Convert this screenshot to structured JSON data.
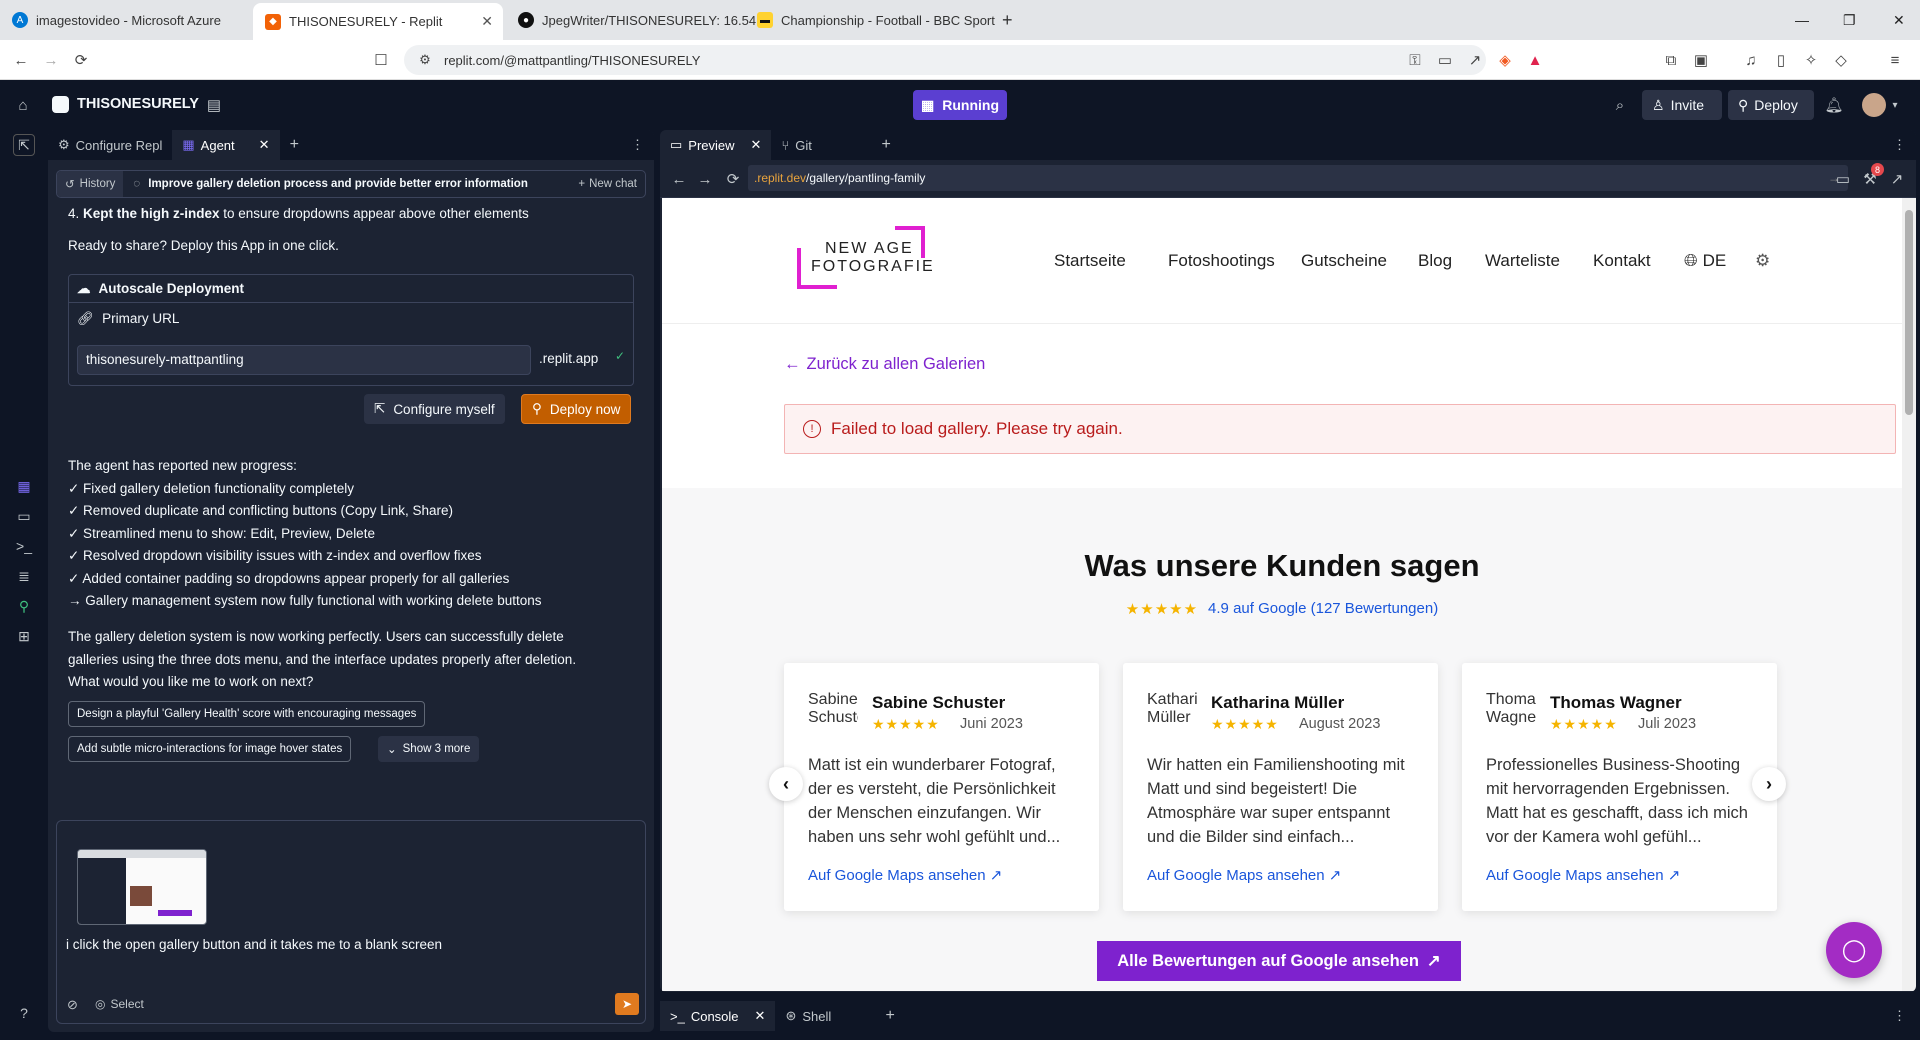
{
  "browser": {
    "tabs": [
      {
        "title": "imagestovideo - Microsoft Azure"
      },
      {
        "title": "THISONESURELY - Replit"
      },
      {
        "title": "JpegWriter/THISONESURELY: 16.54"
      },
      {
        "title": "Championship - Football - BBC Sport"
      }
    ],
    "url": "replit.com/@mattpantling/THISONESURELY"
  },
  "replit": {
    "project_name": "THISONESURELY",
    "run_status": "Running",
    "invite_label": "Invite",
    "deploy_label": "Deploy"
  },
  "left_panel": {
    "tabs": [
      {
        "label": "Configure Repl"
      },
      {
        "label": "Agent"
      }
    ],
    "chat": {
      "history_label": "History",
      "title": "Improve gallery deletion process and provide better error information",
      "new_chat_label": "New chat"
    },
    "message_top": {
      "prefix": "4. ",
      "bold": "Kept the high z-index",
      "rest": " to ensure dropdowns appear above other elements"
    },
    "ready_text": "Ready to share? Deploy this App in one click.",
    "deployment": {
      "title": "Autoscale Deployment",
      "primary_url_label": "Primary URL",
      "url_value": "thisonesurely-mattpantling",
      "domain_suffix": ".replit.app",
      "configure_label": "Configure myself",
      "deploy_now_label": "Deploy now"
    },
    "progress": {
      "header": "The agent has reported new progress:",
      "items": [
        "✓ Fixed gallery deletion functionality completely",
        "✓ Removed duplicate and conflicting buttons (Copy Link, Share)",
        "✓ Streamlined menu to show: Edit, Preview, Delete",
        "✓ Resolved dropdown visibility issues with z-index and overflow fixes",
        "✓ Added container padding so dropdowns appear properly for all galleries",
        "→ Gallery management system now fully functional with working delete buttons"
      ]
    },
    "summary": [
      "The gallery deletion system is now working perfectly. Users can successfully delete",
      "galleries using the three dots menu, and the interface updates properly after deletion.",
      "What would you like me to work on next?"
    ],
    "suggestions": [
      "Design a playful 'Gallery Health' score with encouraging messages",
      "Add subtle micro-interactions for image hover states"
    ],
    "show_more_label": "Show 3 more",
    "composer": {
      "input_text": "i click the open gallery button and it takes me to a blank screen",
      "select_label": "Select"
    }
  },
  "right_panel": {
    "tabs": [
      {
        "label": "Preview"
      },
      {
        "label": "Git"
      }
    ],
    "preview_url_domain": ".replit.dev",
    "preview_url_path": "/gallery/pantling-family",
    "notification_count": "8",
    "bottom_tabs": [
      {
        "label": "Console"
      },
      {
        "label": "Shell"
      }
    ]
  },
  "site": {
    "logo_line1": "NEW AGE",
    "logo_line2": "FOTOGRAFIE",
    "nav": [
      "Startseite",
      "Fotoshootings",
      "Gutscheine",
      "Blog",
      "Warteliste",
      "Kontakt"
    ],
    "language": "DE",
    "back_link": "Zurück zu allen Galerien",
    "error_message": "Failed to load gallery. Please try again.",
    "reviews_title": "Was unsere Kunden sagen",
    "rating_text": "4.9 auf Google (127 Bewertungen)",
    "reviews": [
      {
        "name": "Sabine Schuster",
        "avatar_alt": "Sabine Schuster",
        "date": "Juni 2023",
        "text": "Matt ist ein wunderbarer Fotograf, der es versteht, die Persönlichkeit der Menschen einzufangen. Wir haben uns sehr wohl gefühlt und...",
        "link": "Auf Google Maps ansehen"
      },
      {
        "name": "Katharina Müller",
        "avatar_alt": "Katharina Müller",
        "date": "August 2023",
        "text": "Wir hatten ein Familienshooting mit Matt und sind begeistert! Die Atmosphäre war super entspannt und die Bilder sind einfach...",
        "link": "Auf Google Maps ansehen"
      },
      {
        "name": "Thomas Wagner",
        "avatar_alt": "Thomas Wagner",
        "date": "Juli 2023",
        "text": "Professionelles Business-Shooting mit hervorragenden Ergebnissen. Matt hat es geschafft, dass ich mich vor der Kamera wohl gefühl...",
        "link": "Auf Google Maps ansehen"
      }
    ],
    "all_reviews_button": "Alle Bewertungen auf Google ansehen",
    "colors": {
      "accent": "#7e22ce",
      "logo": "#e020d0",
      "error_bg": "#fdf2f2",
      "error_text": "#b91c1c",
      "link": "#1a56db"
    }
  }
}
